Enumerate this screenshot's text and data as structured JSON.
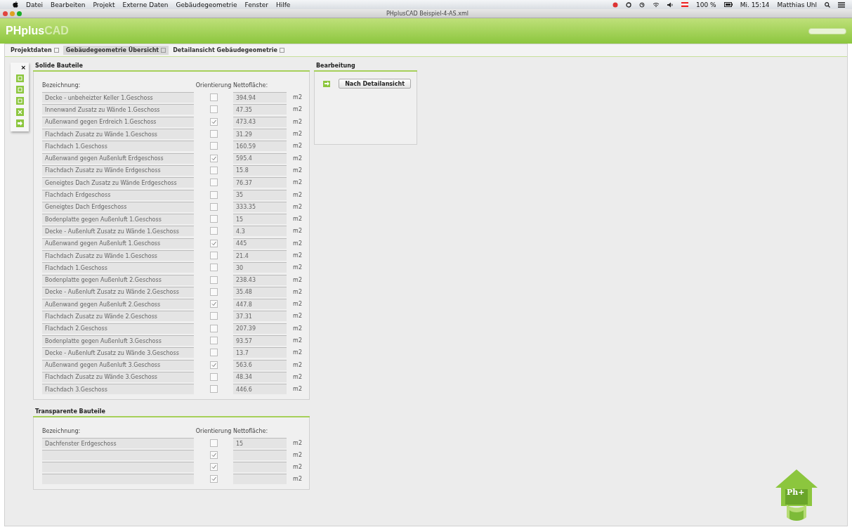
{
  "menu_bar": {
    "items": [
      "Datei",
      "Bearbeiten",
      "Projekt",
      "Externe Daten",
      "Gebäudegeometrie",
      "Fenster",
      "Hilfe"
    ],
    "battery": "100 %",
    "clock": "Mi. 15:14",
    "user": "Matthias Uhl"
  },
  "window": {
    "title": "PHplusCAD Beispiel-4-AS.xml"
  },
  "app_logo": {
    "part1": "PHplus",
    "part2": "CAD"
  },
  "tabs": [
    {
      "label": "Projektdaten",
      "selected": false
    },
    {
      "label": "Gebäudegeometrie Übersicht",
      "selected": true
    },
    {
      "label": "Detailansicht Gebäudegeometrie",
      "selected": false
    }
  ],
  "toolbar": {
    "close": "×"
  },
  "sections": [
    {
      "title": "Solide Bauteile",
      "columns": [
        "Bezeichnung:",
        "Orientierung",
        "Nettofläche:"
      ],
      "rows": [
        {
          "name": "Decke - unbeheizter Keller 1.Geschoss",
          "checked": false,
          "area": "394.94",
          "unit": "m2"
        },
        {
          "name": "Innenwand Zusatz zu Wände 1.Geschoss",
          "checked": false,
          "area": "47.35",
          "unit": "m2"
        },
        {
          "name": "Außenwand gegen Erdreich 1.Geschoss",
          "checked": true,
          "area": "473.43",
          "unit": "m2"
        },
        {
          "name": "Flachdach Zusatz zu Wände 1.Geschoss",
          "checked": false,
          "area": "31.29",
          "unit": "m2"
        },
        {
          "name": "Flachdach 1.Geschoss",
          "checked": false,
          "area": "160.59",
          "unit": "m2"
        },
        {
          "name": "Außenwand gegen Außenluft Erdgeschoss",
          "checked": true,
          "area": "595.4",
          "unit": "m2"
        },
        {
          "name": "Flachdach Zusatz zu Wände Erdgeschoss",
          "checked": false,
          "area": "15.8",
          "unit": "m2"
        },
        {
          "name": "Geneigtes Dach Zusatz zu Wände Erdgeschoss",
          "checked": false,
          "area": "76.37",
          "unit": "m2"
        },
        {
          "name": "Flachdach Erdgeschoss",
          "checked": false,
          "area": "35",
          "unit": "m2"
        },
        {
          "name": "Geneigtes Dach Erdgeschoss",
          "checked": false,
          "area": "333.35",
          "unit": "m2"
        },
        {
          "name": "Bodenplatte gegen Außenluft 1.Geschoss",
          "checked": false,
          "area": "15",
          "unit": "m2"
        },
        {
          "name": "Decke - Außenluft Zusatz zu Wände 1.Geschoss",
          "checked": false,
          "area": "4.3",
          "unit": "m2"
        },
        {
          "name": "Außenwand gegen Außenluft 1.Geschoss",
          "checked": true,
          "area": "445",
          "unit": "m2"
        },
        {
          "name": "Flachdach Zusatz zu Wände 1.Geschoss",
          "checked": false,
          "area": "21.4",
          "unit": "m2"
        },
        {
          "name": "Flachdach 1.Geschoss",
          "checked": false,
          "area": "30",
          "unit": "m2"
        },
        {
          "name": "Bodenplatte gegen Außenluft 2.Geschoss",
          "checked": false,
          "area": "238.43",
          "unit": "m2"
        },
        {
          "name": "Decke - Außenluft Zusatz zu Wände 2.Geschoss",
          "checked": false,
          "area": "35.48",
          "unit": "m2"
        },
        {
          "name": "Außenwand gegen Außenluft 2.Geschoss",
          "checked": true,
          "area": "447.8",
          "unit": "m2"
        },
        {
          "name": "Flachdach Zusatz zu Wände 2.Geschoss",
          "checked": false,
          "area": "37.31",
          "unit": "m2"
        },
        {
          "name": "Flachdach 2.Geschoss",
          "checked": false,
          "area": "207.39",
          "unit": "m2"
        },
        {
          "name": "Bodenplatte gegen Außenluft 3.Geschoss",
          "checked": false,
          "area": "93.57",
          "unit": "m2"
        },
        {
          "name": "Decke - Außenluft Zusatz zu Wände 3.Geschoss",
          "checked": false,
          "area": "13.7",
          "unit": "m2"
        },
        {
          "name": "Außenwand gegen Außenluft 3.Geschoss",
          "checked": true,
          "area": "563.6",
          "unit": "m2"
        },
        {
          "name": "Flachdach Zusatz zu Wände 3.Geschoss",
          "checked": false,
          "area": "48.34",
          "unit": "m2"
        },
        {
          "name": "Flachdach 3.Geschoss",
          "checked": false,
          "area": "446.6",
          "unit": "m2"
        }
      ]
    },
    {
      "title": "Transparente Bauteile",
      "columns": [
        "Bezeichnung:",
        "Orientierung",
        "Nettofläche:"
      ],
      "rows": [
        {
          "name": "Dachfenster Erdgeschoss",
          "checked": false,
          "area": "15",
          "unit": "m2"
        },
        {
          "checked": true,
          "unit": "m2"
        },
        {
          "checked": true,
          "unit": "m2"
        },
        {
          "checked": true,
          "unit": "m2"
        }
      ]
    }
  ],
  "editing": {
    "title": "Bearbeitung",
    "button": "Nach Detailansicht"
  },
  "corner_logo": {
    "text": "Ph+"
  }
}
